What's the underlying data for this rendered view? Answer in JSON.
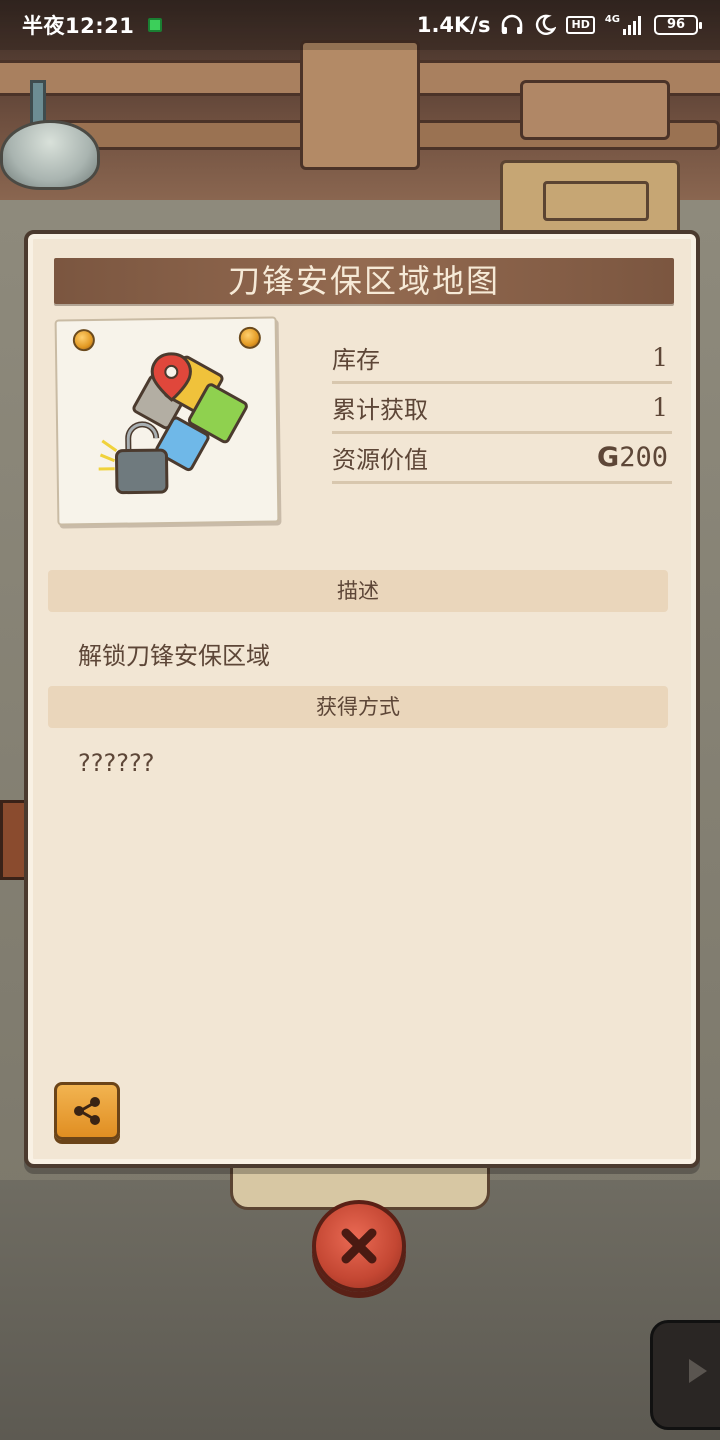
{
  "status_bar": {
    "time": "半夜12:21",
    "network_speed": "1.4K/s",
    "hd_badge": "HD",
    "signal_label": "4G",
    "battery": "96"
  },
  "dialog": {
    "title": "刀锋安保区域地图",
    "item_icon": "map-puzzle-lock-icon",
    "stats": [
      {
        "label": "库存",
        "value": "1"
      },
      {
        "label": "累计获取",
        "value": "1"
      },
      {
        "label": "资源价值",
        "value": "200",
        "currency_symbol": "G"
      }
    ],
    "sections": [
      {
        "heading": "描述",
        "text": "解锁刀锋安保区域"
      },
      {
        "heading": "获得方式",
        "text": "??????"
      }
    ],
    "share_icon": "share-icon",
    "close_icon": "close-icon"
  },
  "colors": {
    "panel_bg": "#f2e6d4",
    "title_banner": "#7b5640",
    "text": "#5d4637",
    "share_button": "#e8a032",
    "close_button": "#c44733"
  }
}
